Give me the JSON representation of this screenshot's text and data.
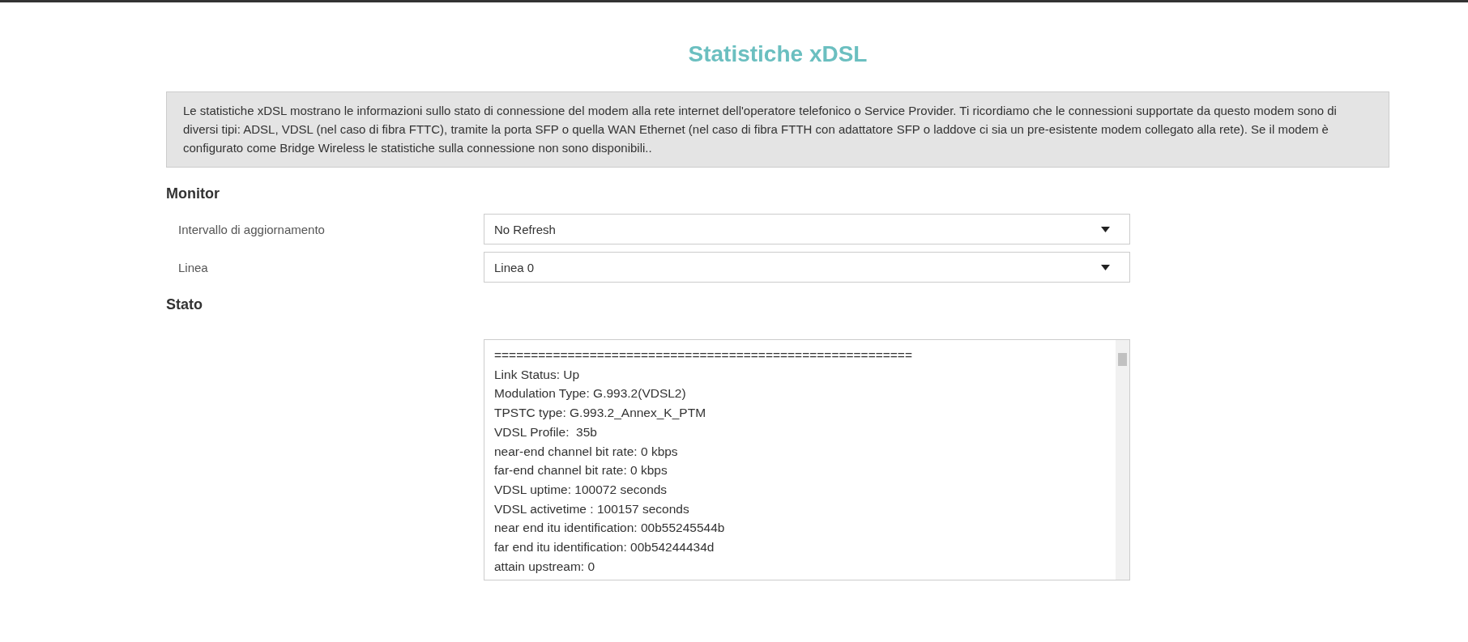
{
  "title": "Statistiche xDSL",
  "info": "Le statistiche xDSL mostrano le informazioni sullo stato di connessione del modem alla rete internet dell'operatore telefonico o Service Provider. Ti ricordiamo che le connessioni supportate da questo modem sono di diversi tipi: ADSL, VDSL (nel caso di fibra FTTC), tramite la porta SFP o quella WAN Ethernet (nel caso di fibra FTTH con adattatore SFP o laddove ci sia un pre-esistente modem collegato alla rete). Se il modem è configurato come Bridge Wireless le statistiche sulla connessione non sono disponibili..",
  "monitor": {
    "heading": "Monitor",
    "fields": [
      {
        "label": "Intervallo di aggiornamento",
        "value": "No Refresh"
      },
      {
        "label": "Linea",
        "value": "Linea 0"
      }
    ]
  },
  "status": {
    "heading": "Stato",
    "lines": [
      "=========================================================",
      "Link Status: Up",
      "Modulation Type: G.993.2(VDSL2)",
      "TPSTC type: G.993.2_Annex_K_PTM",
      "VDSL Profile:  35b",
      "near-end channel bit rate: 0 kbps",
      "far-end channel bit rate: 0 kbps",
      "VDSL uptime: 100072 seconds",
      "VDSL activetime : 100157 seconds",
      "near end itu identification: 00b55245544b",
      "far end itu identification: 00b54244434d",
      "attain upstream: 0"
    ]
  }
}
